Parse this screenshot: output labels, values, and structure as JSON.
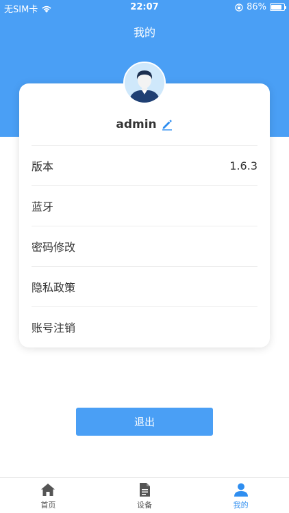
{
  "status_bar": {
    "carrier": "无SIM卡",
    "time": "22:07",
    "battery": "86%",
    "battery_level": 0.86
  },
  "header": {
    "title": "我的"
  },
  "profile": {
    "username": "admin"
  },
  "menu": {
    "items": [
      {
        "label": "版本",
        "value": "1.6.3"
      },
      {
        "label": "蓝牙",
        "value": ""
      },
      {
        "label": "密码修改",
        "value": ""
      },
      {
        "label": "隐私政策",
        "value": ""
      },
      {
        "label": "账号注销",
        "value": ""
      }
    ]
  },
  "logout": {
    "label": "退出"
  },
  "tabbar": {
    "tabs": [
      {
        "label": "首页",
        "icon": "home-icon"
      },
      {
        "label": "设备",
        "icon": "document-icon"
      },
      {
        "label": "我的",
        "icon": "user-icon",
        "active": true
      }
    ]
  },
  "colors": {
    "accent": "#4a9ff5",
    "active_tab": "#2f8ef0"
  }
}
